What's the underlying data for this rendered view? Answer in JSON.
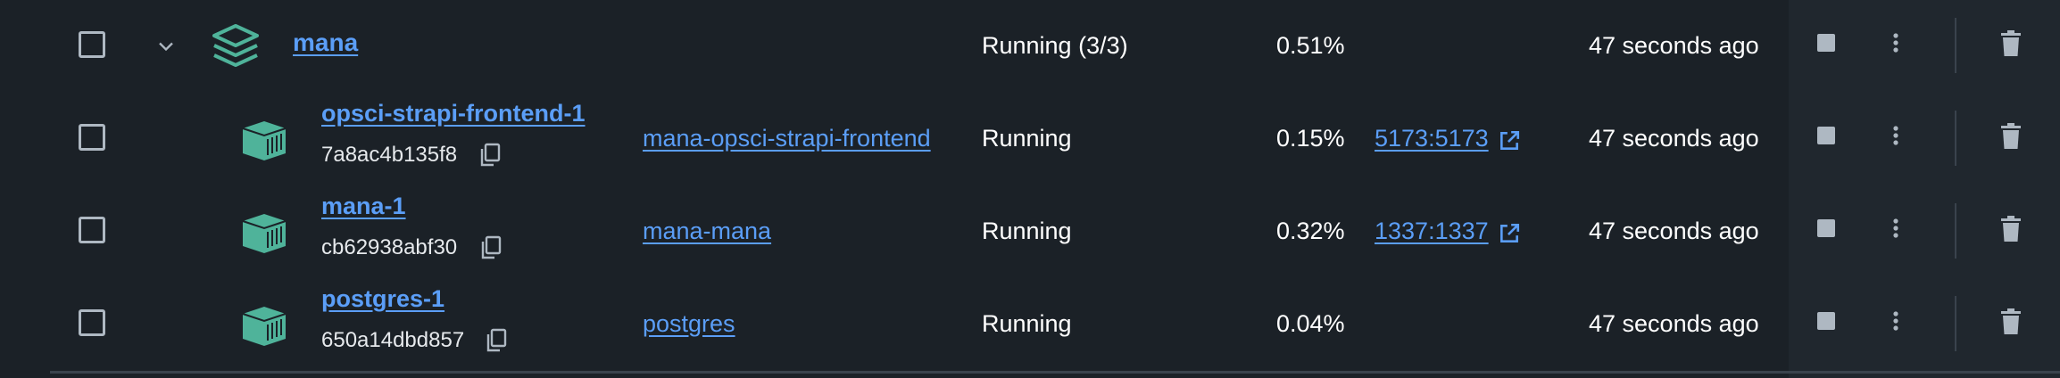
{
  "colors": {
    "background": "#1b2127",
    "actions_background": "#20272e",
    "link": "#5b9ef7",
    "icon_green": "#4fb39a",
    "icon_gray": "#aeb8c2"
  },
  "icons": {
    "stack": "layers-stack-icon",
    "container": "container-box-icon",
    "copy": "copy-icon",
    "external": "external-link-icon",
    "stop": "stop-icon",
    "more": "more-vertical-icon",
    "delete": "trash-icon",
    "expand": "chevron-down-icon"
  },
  "group": {
    "name": "mana",
    "status": "Running (3/3)",
    "cpu": "0.51%",
    "started": "47 seconds ago"
  },
  "containers": [
    {
      "name": "opsci-strapi-frontend-1",
      "id": "7a8ac4b135f8",
      "image": "mana-opsci-strapi-frontend",
      "status": "Running",
      "cpu": "0.15%",
      "ports": "5173:5173",
      "started": "47 seconds ago"
    },
    {
      "name": "mana-1",
      "id": "cb62938abf30",
      "image": "mana-mana",
      "status": "Running",
      "cpu": "0.32%",
      "ports": "1337:1337",
      "started": "47 seconds ago"
    },
    {
      "name": "postgres-1",
      "id": "650a14dbd857",
      "image": "postgres",
      "status": "Running",
      "cpu": "0.04%",
      "ports": "",
      "started": "47 seconds ago"
    }
  ]
}
